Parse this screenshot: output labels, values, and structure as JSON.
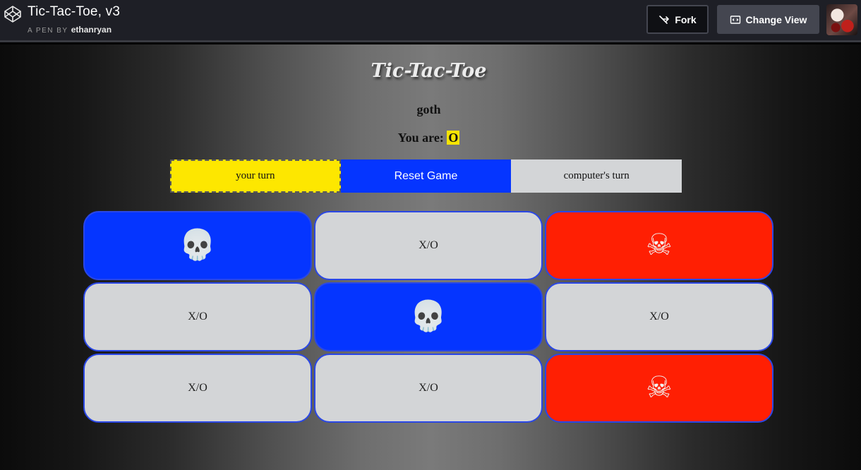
{
  "header": {
    "pen_title": "Tic-Tac-Toe, v3",
    "meta_prefix": "A PEN BY",
    "author": "ethanryan",
    "fork_label": "Fork",
    "change_view_label": "Change View"
  },
  "game": {
    "title": "Tic-Tac-Toe",
    "player_name": "goth",
    "you_are_label": "You are:",
    "player_marker": "O",
    "your_turn_label": "your turn",
    "reset_label": "Reset Game",
    "computer_turn_label": "computer's turn"
  },
  "board": {
    "squares": [
      {
        "content": "💀",
        "state": "player"
      },
      {
        "content": "X/O",
        "state": "empty"
      },
      {
        "content": "☠",
        "state": "computer"
      },
      {
        "content": "X/O",
        "state": "empty"
      },
      {
        "content": "💀",
        "state": "player"
      },
      {
        "content": "X/O",
        "state": "empty"
      },
      {
        "content": "X/O",
        "state": "empty"
      },
      {
        "content": "X/O",
        "state": "empty"
      },
      {
        "content": "☠",
        "state": "computer"
      }
    ]
  },
  "colors": {
    "player_square": "#0535ff",
    "computer_square": "#ff1f03",
    "empty_square": "#d3d5d7",
    "your_turn": "#fde700",
    "reset": "#0535ff"
  },
  "icons": {
    "logo": "codepen-logo-icon",
    "fork": "fork-icon",
    "change_view": "change-view-icon"
  }
}
